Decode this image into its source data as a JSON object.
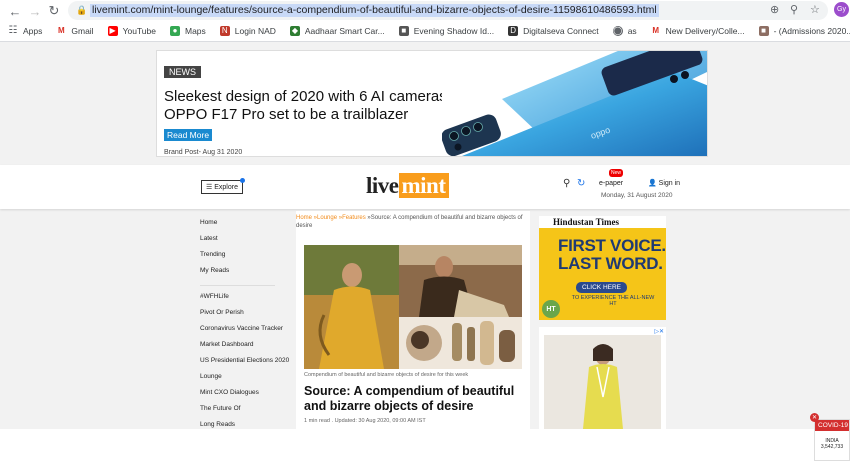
{
  "browser": {
    "url": "livemint.com/mint-lounge/features/source-a-compendium-of-beautiful-and-bizarre-objects-of-desire-11598610486593.html",
    "avatar_initials": "Gy",
    "bookmarks": [
      {
        "label": "Apps",
        "icon": "apps-grid-icon",
        "color": "#5f6368"
      },
      {
        "label": "Gmail",
        "icon": "gmail-icon",
        "color": "#d93025"
      },
      {
        "label": "YouTube",
        "icon": "youtube-icon",
        "color": "#ff0000"
      },
      {
        "label": "Maps",
        "icon": "maps-icon",
        "color": "#34a853"
      },
      {
        "label": "Login NAD",
        "icon": "nad-icon",
        "color": "#c0392b"
      },
      {
        "label": "Aadhaar Smart Car...",
        "icon": "aadhaar-icon",
        "color": "#2e7d32"
      },
      {
        "label": "Evening Shadow Id...",
        "icon": "shadow-icon",
        "color": "#555555"
      },
      {
        "label": "Digitalseva Connect",
        "icon": "digitalseva-icon",
        "color": "#333333"
      },
      {
        "label": "as",
        "icon": "globe-icon",
        "color": "#5f6368"
      },
      {
        "label": "New Delivery/Colle...",
        "icon": "gmail-icon",
        "color": "#d93025"
      },
      {
        "label": "- (Admissions 2020...",
        "icon": "admissions-icon",
        "color": "#8d6e63"
      }
    ]
  },
  "ad_top": {
    "tag": "NEWS",
    "headline_line1": "Sleekest design of 2020 with 6 AI cameras!",
    "headline_line2": "OPPO F17 Pro set to be a trailblazer",
    "cta": "Read More",
    "byline": "Brand Post- Aug 31 2020"
  },
  "header": {
    "explore_label": "Explore",
    "logo_part1": "live",
    "logo_part2": "mint",
    "epaper_label": "e-paper",
    "new_badge": "New",
    "signin_label": "Sign in",
    "date": "Monday, 31 August 2020"
  },
  "sidebar": {
    "group1": [
      "Home",
      "Latest",
      "Trending",
      "My Reads"
    ],
    "group2": [
      "#WFHLife",
      "Pivot Or Perish",
      "Coronavirus Vaccine Tracker",
      "Market Dashboard",
      "US Presidential Elections 2020",
      "Lounge",
      "Mint CXO Dialogues",
      "The Future Of",
      "Long Reads"
    ]
  },
  "article": {
    "breadcrumb": {
      "home": "Home",
      "lounge": "Lounge",
      "features": "Features",
      "current": "Source: A compendium of beautiful and bizarre objects of desire"
    },
    "image_caption": "Compendium of beautiful and bizarre objects of desire for this week",
    "title": "Source: A compendium of beautiful and bizarre objects of desire",
    "meta": "1 min read . Updated: 30 Aug 2020, 09:00 AM IST"
  },
  "ht_ad": {
    "masthead": "Hindustan Times",
    "line1": "FIRST VOICE.",
    "line2": "LAST WORD.",
    "button": "CLICK HERE",
    "sub": "TO EXPERIENCE THE ALL-NEW HT",
    "badge": "HT"
  },
  "covid": {
    "title": "COVID-19",
    "country": "INDIA",
    "count": "3,542,733"
  }
}
